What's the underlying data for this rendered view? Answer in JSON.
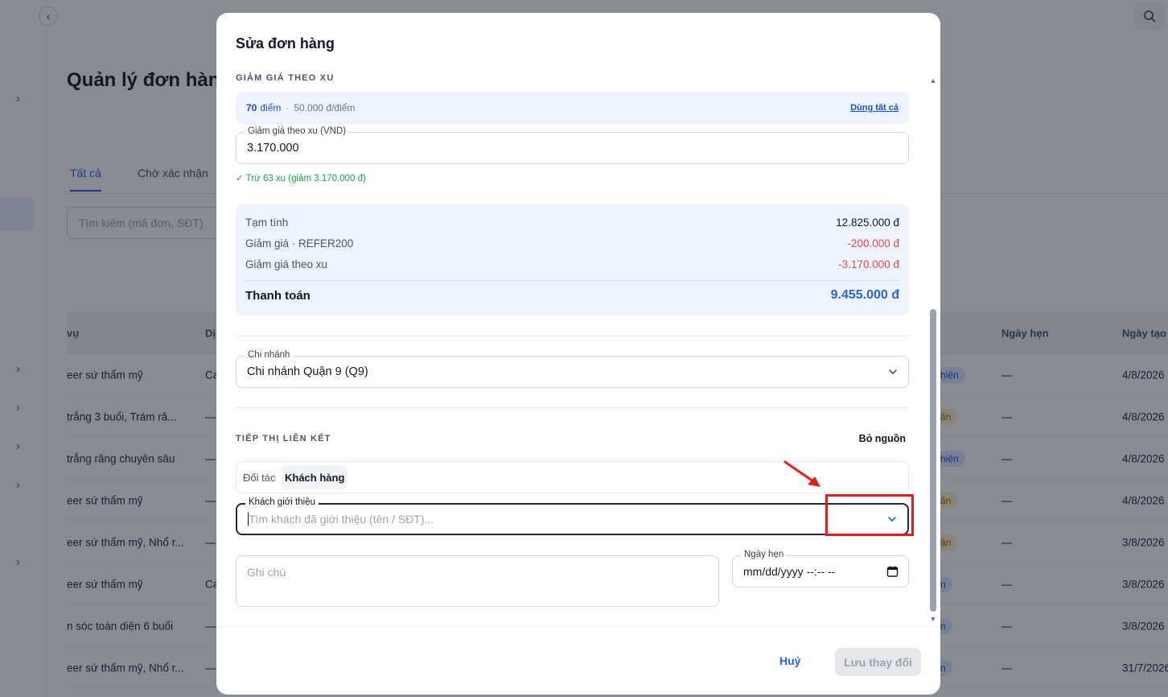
{
  "background": {
    "page_title": "Quản lý đơn hàng",
    "tabs": [
      "Tất cả",
      "Chờ xác nhận"
    ],
    "search_placeholder": "Tìm kiếm (mã đơn, SĐT)",
    "table": {
      "headers": [
        "vụ",
        "Dị",
        "Ngày hẹn",
        "Ngày tạo"
      ],
      "rows": [
        {
          "service": "eer sứ thẩm mỹ",
          "col2": "Ca",
          "status": "hiện",
          "status_color": "blue",
          "appt": "—",
          "created": "4/8/2026"
        },
        {
          "service": "trắng 3 buổi, Trám ră...",
          "col2": "—",
          "status": "ận",
          "status_color": "amber",
          "appt": "—",
          "created": "4/8/2026"
        },
        {
          "service": "trắng răng chuyên sâu",
          "col2": "—",
          "status": "hiện",
          "status_color": "blue",
          "appt": "—",
          "created": "4/8/2026"
        },
        {
          "service": "eer sứ thẩm mỹ",
          "col2": "—",
          "status": "ận",
          "status_color": "amber",
          "appt": "—",
          "created": "4/8/2026"
        },
        {
          "service": "eer sứ thẩm mỹ, Nhổ r...",
          "col2": "—",
          "status": "ận",
          "status_color": "amber",
          "appt": "—",
          "created": "3/8/2026"
        },
        {
          "service": "eer sứ thẩm mỹ",
          "col2": "Ca",
          "status": "n",
          "status_color": "blue",
          "appt": "—",
          "created": "3/8/2026"
        },
        {
          "service": "n sóc toàn diện 6 buổi",
          "col2": "—",
          "status": "n",
          "status_color": "blue",
          "appt": "—",
          "created": "3/8/2026"
        },
        {
          "service": "eer sứ thẩm mỹ, Nhổ r...",
          "col2": "—",
          "status": "n",
          "status_color": "blue",
          "appt": "—",
          "created": "31/7/2026"
        }
      ]
    }
  },
  "modal": {
    "title": "Sửa đơn hàng",
    "coin_section": {
      "label": "GIẢM GIÁ THEO XU",
      "points_value": "70",
      "points_unit": "điểm",
      "rate": "50.000 đ/điểm",
      "use_all": "Dùng tất cả",
      "input_label": "Giảm giá theo xu (VND)",
      "input_value": "3.170.000",
      "note": "✓ Trừ 63 xu (giảm 3.170.000 đ)"
    },
    "summary": {
      "rows": [
        {
          "label": "Tạm tính",
          "value": "12.825.000 đ"
        },
        {
          "label": "Giảm giá · REFER200",
          "value": "-200.000 đ"
        },
        {
          "label": "Giảm giá theo xu",
          "value": "-3.170.000 đ"
        }
      ],
      "total_label": "Thanh toán",
      "total_value": "9.455.000 đ"
    },
    "branch": {
      "label": "Chi nhánh",
      "value": "Chi nhánh Quận 9 (Q9)"
    },
    "affiliate": {
      "label": "TIẾP THỊ LIÊN KẾT",
      "remove": "Bỏ nguồn",
      "tabs": [
        "Đối tác",
        "Khách hàng"
      ],
      "active_tab": "Khách hàng",
      "referrer_label": "Khách giới thiệu",
      "referrer_placeholder": "Tìm khách đã giới thiệu (tên / SĐT)..."
    },
    "note_placeholder": "Ghi chú",
    "appointment": {
      "label": "Ngày hẹn",
      "placeholder": "mm/dd/yyyy --:-- --"
    },
    "footer": {
      "cancel": "Huỷ",
      "save": "Lưu thay đổi"
    }
  },
  "colors": {
    "accent": "#2563eb",
    "negative": "#ef4444",
    "success": "#16a34a",
    "annotation": "#e11d1d"
  }
}
